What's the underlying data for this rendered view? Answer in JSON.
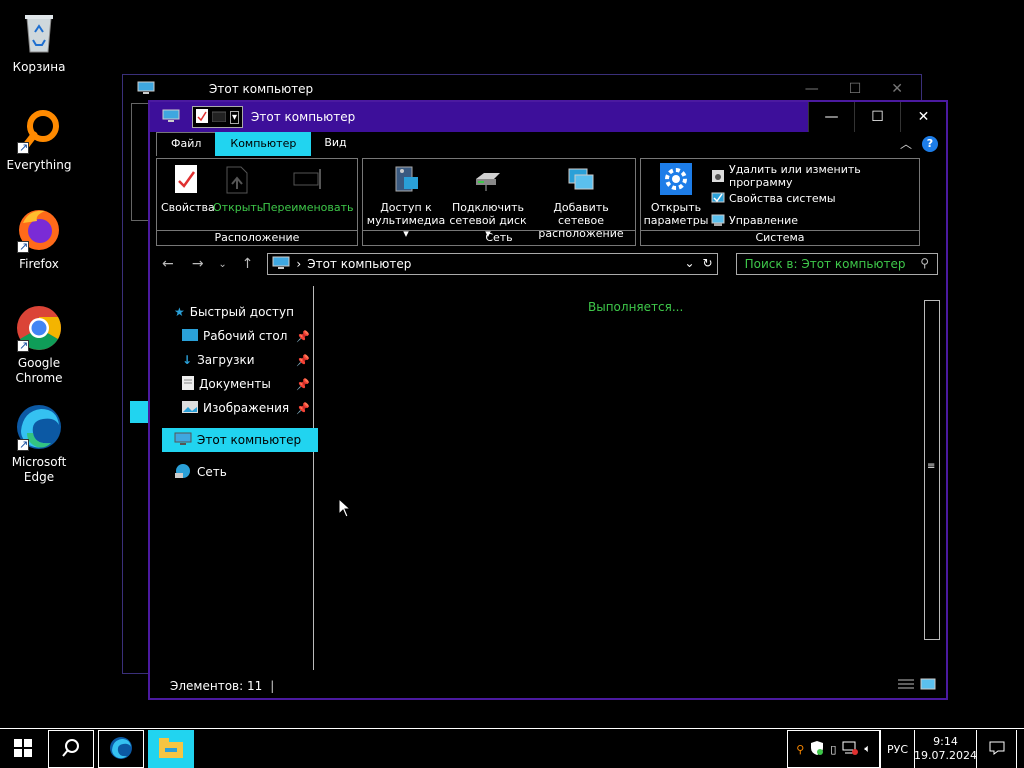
{
  "desktop": {
    "icons": [
      {
        "label": "Корзина",
        "icon": "recycle-bin-icon"
      },
      {
        "label": "Everything",
        "icon": "everything-search-icon"
      },
      {
        "label": "Firefox",
        "icon": "firefox-icon"
      },
      {
        "label": "Google Chrome",
        "icon": "chrome-icon"
      },
      {
        "label": "Microsoft Edge",
        "icon": "edge-icon"
      }
    ]
  },
  "back_window": {
    "title": "Этот компьютер"
  },
  "window": {
    "title": "Этот компьютер",
    "controls": {
      "minimize": "—",
      "maximize": "☐",
      "close": "✕"
    }
  },
  "ribbon": {
    "tabs": [
      {
        "label": "Файл"
      },
      {
        "label": "Компьютер",
        "active": true
      },
      {
        "label": "Вид"
      }
    ],
    "groups": {
      "location": {
        "label": "Расположение",
        "buttons": [
          "Свойства",
          "Открыть",
          "Переименовать"
        ]
      },
      "network": {
        "label": "Сеть",
        "buttons": [
          "Доступ к",
          "мультимедиа",
          "Подключить",
          "сетевой диск",
          "Добавить сетевое",
          "расположение"
        ]
      },
      "system": {
        "label": "Система",
        "open_settings": [
          "Открыть",
          "параметры"
        ],
        "items": [
          "Удалить или изменить программу",
          "Свойства системы",
          "Управление"
        ]
      }
    }
  },
  "address": {
    "path": "Этот компьютер",
    "search_placeholder": "Поиск в: Этот компьютер"
  },
  "nav": {
    "quick_access": "Быстрый доступ",
    "items": [
      "Рабочий стол",
      "Загрузки",
      "Документы",
      "Изображения"
    ],
    "this_pc": "Этот компьютер",
    "network": "Сеть"
  },
  "content": {
    "status_text": "Выполняется..."
  },
  "statusbar": {
    "items": "Элементов: 11"
  },
  "taskbar": {
    "language": "РУС",
    "time": "9:14",
    "date": "19.07.2024"
  },
  "colors": {
    "accent": "#21d4f0",
    "titlebar": "#3d0f9a",
    "green_text": "#3ec84a"
  }
}
